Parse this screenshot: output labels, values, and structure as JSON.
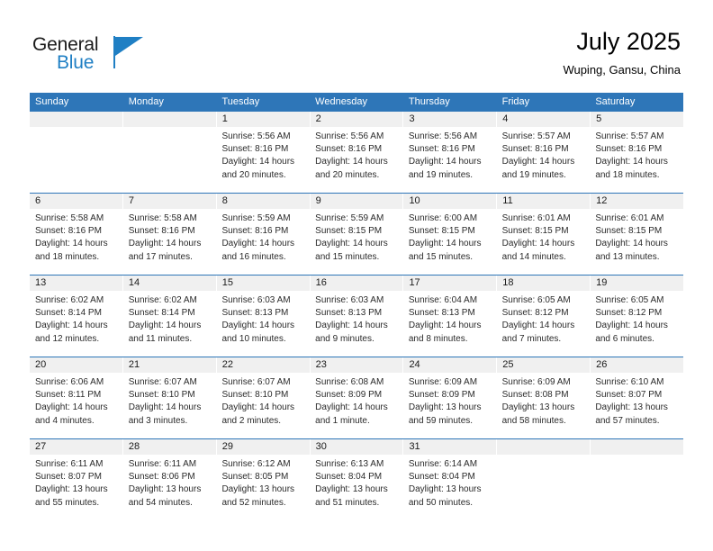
{
  "brand": {
    "name_primary": "General",
    "name_secondary": "Blue",
    "primary_color": "#1a1a1a",
    "secondary_color": "#1f7fc4"
  },
  "header": {
    "title": "July 2025",
    "subtitle": "Wuping, Gansu, China"
  },
  "theme": {
    "header_blue": "#2e76b8",
    "date_band_gray": "#f0f0f0"
  },
  "weekdays": [
    "Sunday",
    "Monday",
    "Tuesday",
    "Wednesday",
    "Thursday",
    "Friday",
    "Saturday"
  ],
  "weeks": [
    [
      {
        "date": "",
        "lines": []
      },
      {
        "date": "",
        "lines": []
      },
      {
        "date": "1",
        "lines": [
          "Sunrise: 5:56 AM",
          "Sunset: 8:16 PM",
          "Daylight: 14 hours",
          "and 20 minutes."
        ]
      },
      {
        "date": "2",
        "lines": [
          "Sunrise: 5:56 AM",
          "Sunset: 8:16 PM",
          "Daylight: 14 hours",
          "and 20 minutes."
        ]
      },
      {
        "date": "3",
        "lines": [
          "Sunrise: 5:56 AM",
          "Sunset: 8:16 PM",
          "Daylight: 14 hours",
          "and 19 minutes."
        ]
      },
      {
        "date": "4",
        "lines": [
          "Sunrise: 5:57 AM",
          "Sunset: 8:16 PM",
          "Daylight: 14 hours",
          "and 19 minutes."
        ]
      },
      {
        "date": "5",
        "lines": [
          "Sunrise: 5:57 AM",
          "Sunset: 8:16 PM",
          "Daylight: 14 hours",
          "and 18 minutes."
        ]
      }
    ],
    [
      {
        "date": "6",
        "lines": [
          "Sunrise: 5:58 AM",
          "Sunset: 8:16 PM",
          "Daylight: 14 hours",
          "and 18 minutes."
        ]
      },
      {
        "date": "7",
        "lines": [
          "Sunrise: 5:58 AM",
          "Sunset: 8:16 PM",
          "Daylight: 14 hours",
          "and 17 minutes."
        ]
      },
      {
        "date": "8",
        "lines": [
          "Sunrise: 5:59 AM",
          "Sunset: 8:16 PM",
          "Daylight: 14 hours",
          "and 16 minutes."
        ]
      },
      {
        "date": "9",
        "lines": [
          "Sunrise: 5:59 AM",
          "Sunset: 8:15 PM",
          "Daylight: 14 hours",
          "and 15 minutes."
        ]
      },
      {
        "date": "10",
        "lines": [
          "Sunrise: 6:00 AM",
          "Sunset: 8:15 PM",
          "Daylight: 14 hours",
          "and 15 minutes."
        ]
      },
      {
        "date": "11",
        "lines": [
          "Sunrise: 6:01 AM",
          "Sunset: 8:15 PM",
          "Daylight: 14 hours",
          "and 14 minutes."
        ]
      },
      {
        "date": "12",
        "lines": [
          "Sunrise: 6:01 AM",
          "Sunset: 8:15 PM",
          "Daylight: 14 hours",
          "and 13 minutes."
        ]
      }
    ],
    [
      {
        "date": "13",
        "lines": [
          "Sunrise: 6:02 AM",
          "Sunset: 8:14 PM",
          "Daylight: 14 hours",
          "and 12 minutes."
        ]
      },
      {
        "date": "14",
        "lines": [
          "Sunrise: 6:02 AM",
          "Sunset: 8:14 PM",
          "Daylight: 14 hours",
          "and 11 minutes."
        ]
      },
      {
        "date": "15",
        "lines": [
          "Sunrise: 6:03 AM",
          "Sunset: 8:13 PM",
          "Daylight: 14 hours",
          "and 10 minutes."
        ]
      },
      {
        "date": "16",
        "lines": [
          "Sunrise: 6:03 AM",
          "Sunset: 8:13 PM",
          "Daylight: 14 hours",
          "and 9 minutes."
        ]
      },
      {
        "date": "17",
        "lines": [
          "Sunrise: 6:04 AM",
          "Sunset: 8:13 PM",
          "Daylight: 14 hours",
          "and 8 minutes."
        ]
      },
      {
        "date": "18",
        "lines": [
          "Sunrise: 6:05 AM",
          "Sunset: 8:12 PM",
          "Daylight: 14 hours",
          "and 7 minutes."
        ]
      },
      {
        "date": "19",
        "lines": [
          "Sunrise: 6:05 AM",
          "Sunset: 8:12 PM",
          "Daylight: 14 hours",
          "and 6 minutes."
        ]
      }
    ],
    [
      {
        "date": "20",
        "lines": [
          "Sunrise: 6:06 AM",
          "Sunset: 8:11 PM",
          "Daylight: 14 hours",
          "and 4 minutes."
        ]
      },
      {
        "date": "21",
        "lines": [
          "Sunrise: 6:07 AM",
          "Sunset: 8:10 PM",
          "Daylight: 14 hours",
          "and 3 minutes."
        ]
      },
      {
        "date": "22",
        "lines": [
          "Sunrise: 6:07 AM",
          "Sunset: 8:10 PM",
          "Daylight: 14 hours",
          "and 2 minutes."
        ]
      },
      {
        "date": "23",
        "lines": [
          "Sunrise: 6:08 AM",
          "Sunset: 8:09 PM",
          "Daylight: 14 hours",
          "and 1 minute."
        ]
      },
      {
        "date": "24",
        "lines": [
          "Sunrise: 6:09 AM",
          "Sunset: 8:09 PM",
          "Daylight: 13 hours",
          "and 59 minutes."
        ]
      },
      {
        "date": "25",
        "lines": [
          "Sunrise: 6:09 AM",
          "Sunset: 8:08 PM",
          "Daylight: 13 hours",
          "and 58 minutes."
        ]
      },
      {
        "date": "26",
        "lines": [
          "Sunrise: 6:10 AM",
          "Sunset: 8:07 PM",
          "Daylight: 13 hours",
          "and 57 minutes."
        ]
      }
    ],
    [
      {
        "date": "27",
        "lines": [
          "Sunrise: 6:11 AM",
          "Sunset: 8:07 PM",
          "Daylight: 13 hours",
          "and 55 minutes."
        ]
      },
      {
        "date": "28",
        "lines": [
          "Sunrise: 6:11 AM",
          "Sunset: 8:06 PM",
          "Daylight: 13 hours",
          "and 54 minutes."
        ]
      },
      {
        "date": "29",
        "lines": [
          "Sunrise: 6:12 AM",
          "Sunset: 8:05 PM",
          "Daylight: 13 hours",
          "and 52 minutes."
        ]
      },
      {
        "date": "30",
        "lines": [
          "Sunrise: 6:13 AM",
          "Sunset: 8:04 PM",
          "Daylight: 13 hours",
          "and 51 minutes."
        ]
      },
      {
        "date": "31",
        "lines": [
          "Sunrise: 6:14 AM",
          "Sunset: 8:04 PM",
          "Daylight: 13 hours",
          "and 50 minutes."
        ]
      },
      {
        "date": "",
        "lines": []
      },
      {
        "date": "",
        "lines": []
      }
    ]
  ]
}
